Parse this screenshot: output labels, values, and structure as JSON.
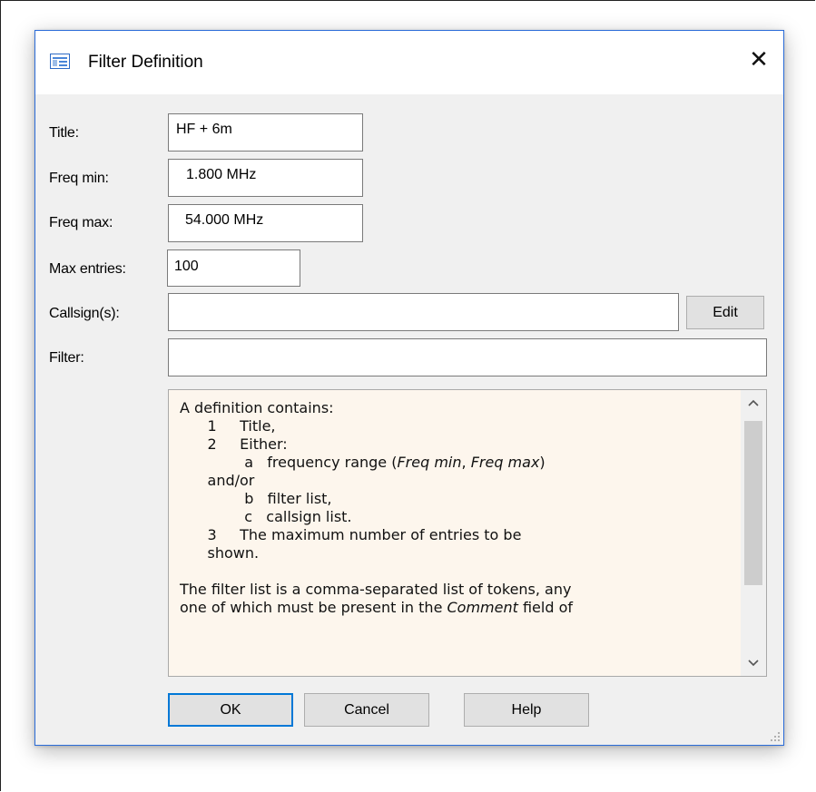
{
  "dialog": {
    "title": "Filter Definition",
    "close_glyph": "✕",
    "icon": "form-window-icon"
  },
  "fields": {
    "title_label": "Title:",
    "title_value": "HF + 6m",
    "freq_min_label": "Freq min:",
    "freq_min_value": "1.800 MHz",
    "freq_max_label": "Freq max:",
    "freq_max_value": "54.000 MHz",
    "max_entries_label": "Max entries:",
    "max_entries_value": "100",
    "callsigns_label": "Callsign(s):",
    "callsigns_value": "",
    "filter_label": "Filter:",
    "filter_value": ""
  },
  "buttons": {
    "edit": "Edit",
    "ok": "OK",
    "cancel": "Cancel",
    "help": "Help"
  },
  "help_text": {
    "line1": "A definition contains:",
    "line2_num": "1",
    "line2_text": "Title,",
    "line3_num": "2",
    "line3_text": "Either:",
    "line4_letter": "a",
    "line4_text": "frequency range (",
    "line4_em1": "Freq min",
    "line4_sep": ", ",
    "line4_em2": "Freq max",
    "line4_end": ")",
    "line5": "and/or",
    "line6_letter": "b",
    "line6_text": "filter list,",
    "line7_letter": "c",
    "line7_text": "callsign list.",
    "line8_num": "3",
    "line8_text": "The maximum number of entries to be",
    "line9": "shown.",
    "line10": "The filter list is a comma-separated list of tokens, any",
    "line11_a": "one of which must be present in the ",
    "line11_em": "Comment",
    "line11_b": " field of"
  },
  "scrollbar": {
    "up_glyph": "^",
    "down_glyph": "v"
  }
}
